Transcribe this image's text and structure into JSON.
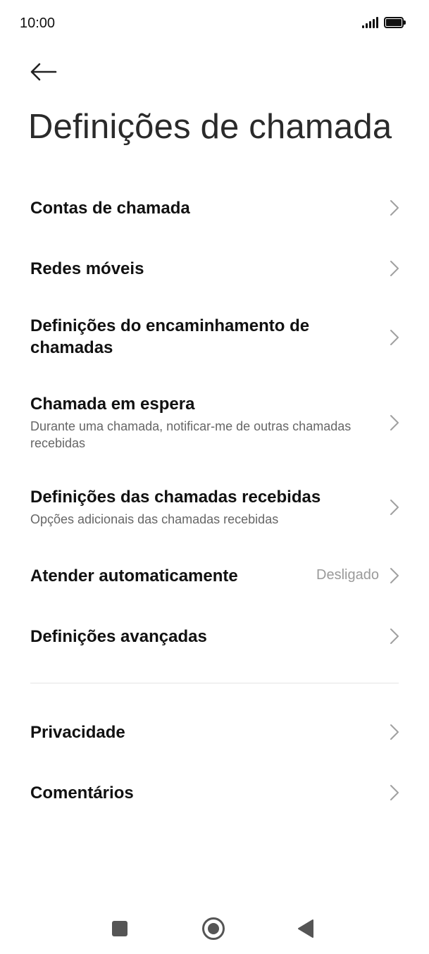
{
  "status_bar": {
    "time": "10:00",
    "icons": [
      "signal-icon",
      "battery-icon"
    ]
  },
  "header": {
    "back_icon": "arrow-left-icon",
    "title": "Definições de chamada"
  },
  "settings": [
    {
      "title": "Contas de chamada"
    },
    {
      "title": "Redes móveis"
    },
    {
      "title": "Definições do encaminhamento de chamadas"
    },
    {
      "title": "Chamada em espera",
      "subtitle": "Durante uma chamada, notificar-me de outras chamadas recebidas"
    },
    {
      "title": "Definições das chamadas recebidas",
      "subtitle": "Opções adicionais das chamadas recebidas"
    },
    {
      "title": "Atender automaticamente",
      "value": "Desligado"
    },
    {
      "title": "Definições avançadas"
    },
    {
      "title": "Privacidade"
    },
    {
      "title": "Comentários"
    }
  ],
  "nav_bar": {
    "icons": [
      "recents-square-icon",
      "home-circle-icon",
      "back-triangle-icon"
    ]
  },
  "colors": {
    "text": "#111111",
    "secondary_text": "#666666",
    "value_text": "#9a9a9a",
    "chevron": "#a0a0a0",
    "divider": "#e4e4e4",
    "background": "#ffffff"
  }
}
